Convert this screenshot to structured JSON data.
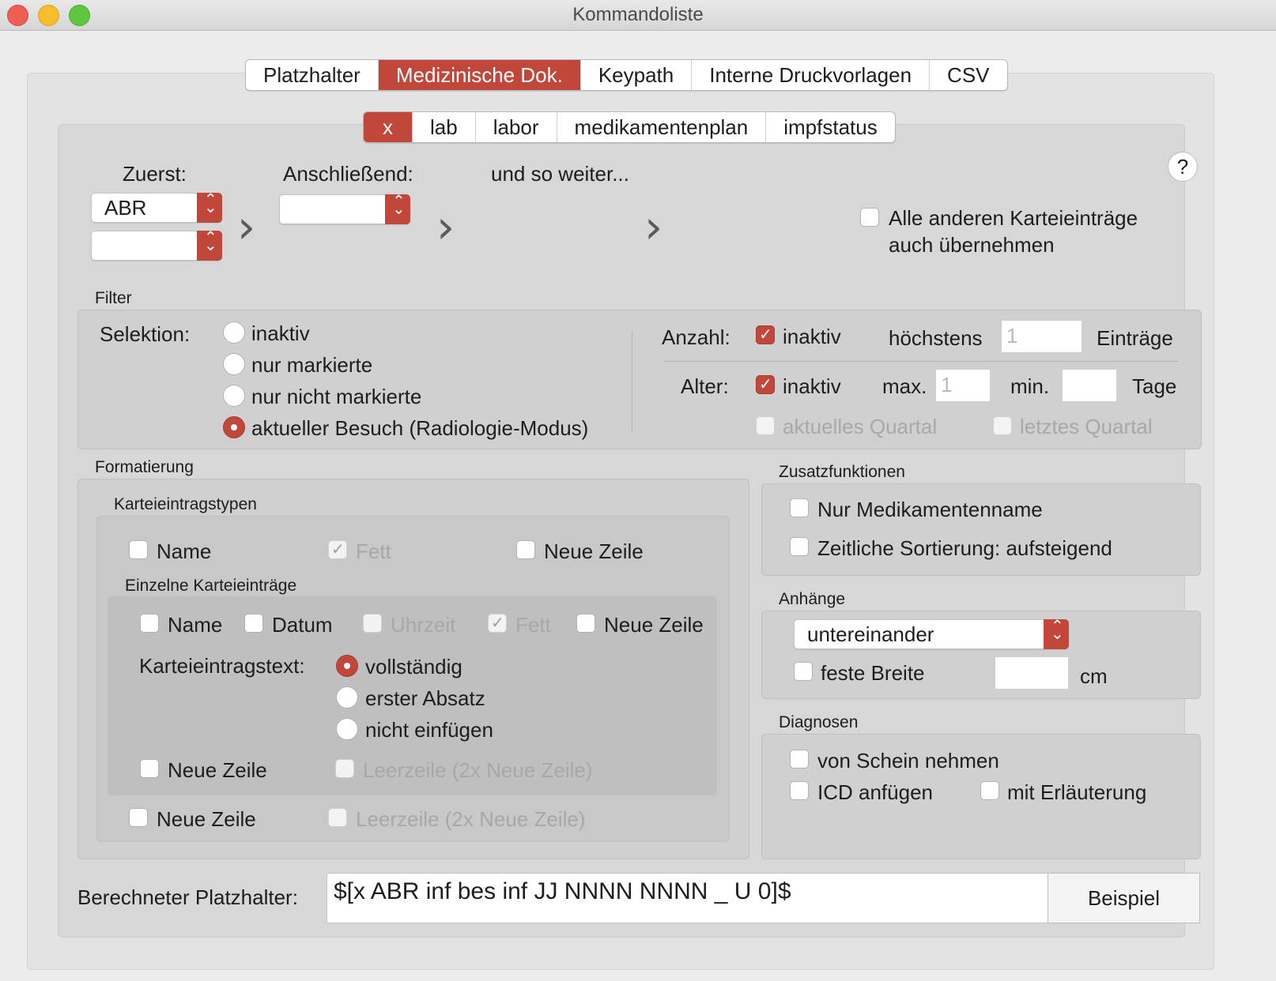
{
  "window": {
    "title": "Kommandoliste"
  },
  "tabs": [
    "Platzhalter",
    "Medizinische Dok.",
    "Keypath",
    "Interne Druckvorlagen",
    "CSV"
  ],
  "subtabs": [
    "x",
    "lab",
    "labor",
    "medikamentenplan",
    "impfstatus"
  ],
  "help": "?",
  "order": {
    "first_label": "Zuerst:",
    "first_value": "ABR",
    "second_value": "",
    "next_label": "Anschließend:",
    "next_value": "",
    "more_label": "und so weiter...",
    "all_others_line1": "Alle anderen Karteieinträge",
    "all_others_line2": "auch übernehmen"
  },
  "filter": {
    "title": "Filter",
    "selection_label": "Selektion:",
    "options": [
      "inaktiv",
      "nur markierte",
      "nur nicht markierte",
      "aktueller Besuch (Radiologie-Modus)"
    ],
    "count_label": "Anzahl:",
    "count_inactive": "inaktiv",
    "at_most": "höchstens",
    "count_value": "1",
    "entries": "Einträge",
    "age_label": "Alter:",
    "age_inactive": "inaktiv",
    "max_label": "max.",
    "max_value": "1",
    "min_label": "min.",
    "min_value": "",
    "days": "Tage",
    "current_quarter": "aktuelles Quartal",
    "last_quarter": "letztes Quartal"
  },
  "formatting": {
    "title": "Formatierung",
    "types_title": "Karteieintragstypen",
    "name": "Name",
    "bold": "Fett",
    "new_line": "Neue Zeile",
    "single_title": "Einzelne Karteieinträge",
    "date": "Datum",
    "time": "Uhrzeit",
    "text_label": "Karteieintragstext:",
    "text_options": [
      "vollständig",
      "erster Absatz",
      "nicht einfügen"
    ],
    "blank_line": "Leerzeile (2x Neue Zeile)"
  },
  "extras": {
    "title": "Zusatzfunktionen",
    "med_name": "Nur Medikamentenname",
    "sort": "Zeitliche Sortierung: aufsteigend"
  },
  "attachments": {
    "title": "Anhänge",
    "mode": "untereinander",
    "fixed_width": "feste Breite",
    "width_value": "",
    "unit": "cm"
  },
  "diagnoses": {
    "title": "Diagnosen",
    "from_schein": "von Schein nehmen",
    "add_icd": "ICD anfügen",
    "with_explanation": "mit Erläuterung"
  },
  "computed": {
    "label": "Berechneter Platzhalter:",
    "value": "$[x ABR inf bes inf JJ NNNN NNNN _ U 0]$",
    "example_button": "Beispiel"
  },
  "colors": {
    "accent": "#c0473a",
    "background": "#ececec"
  }
}
